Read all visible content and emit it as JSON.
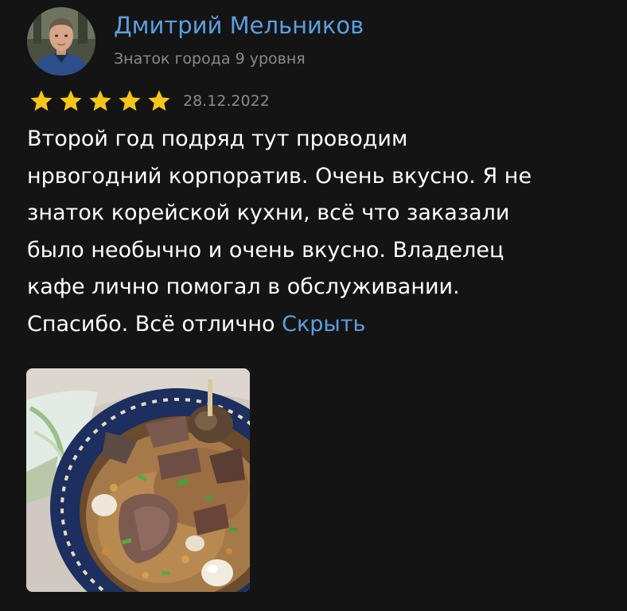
{
  "review": {
    "author": {
      "name": "Дмитрий Мельников",
      "level": "Знаток города 9 уровня"
    },
    "rating": 5,
    "rating_max": 5,
    "date": "28.12.2022",
    "text_lines": [
      "Второй год подряд тут проводим",
      "нрвогодний корпоратив. Очень вкусно. Я не",
      "знаток корейской кухни, всё что заказали",
      "было необычно и очень вкусно. Владелец",
      "кафе лично помогал в обслуживании.",
      "Спасибо. Всё отлично"
    ],
    "hide_label": "Скрыть"
  },
  "colors": {
    "background": "#141414",
    "accent_link": "#5b9fe0",
    "secondary_text": "#8a8a8a",
    "star": "#f5c518"
  }
}
